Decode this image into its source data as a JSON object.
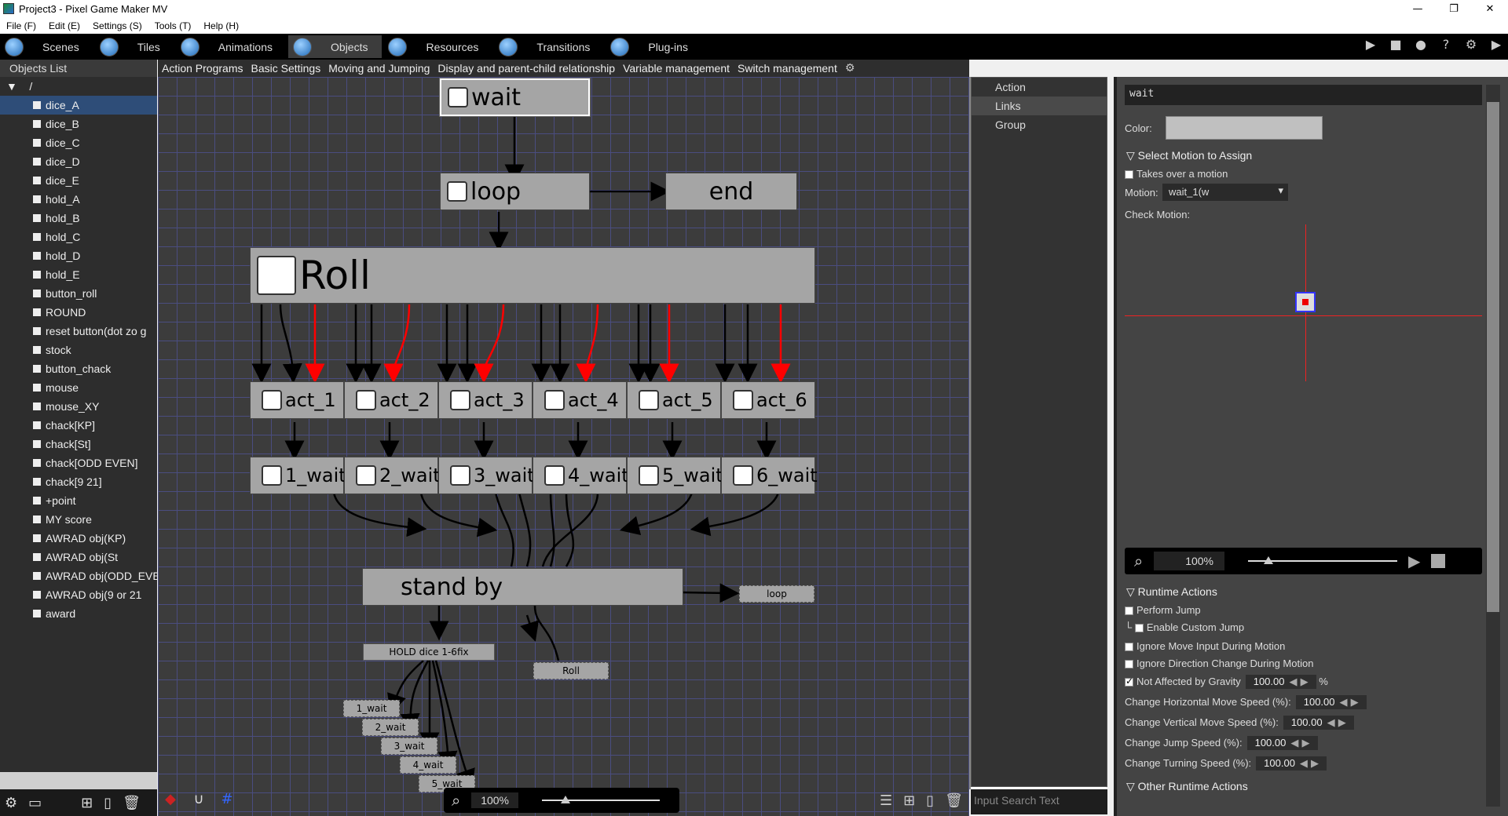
{
  "window": {
    "title": "Project3 - Pixel Game Maker MV",
    "min": "—",
    "max": "❐",
    "close": "✕"
  },
  "menu": [
    "File (F)",
    "Edit (E)",
    "Settings (S)",
    "Tools (T)",
    "Help (H)"
  ],
  "tabs": [
    {
      "label": "Scenes"
    },
    {
      "label": "Tiles"
    },
    {
      "label": "Animations"
    },
    {
      "label": "Objects",
      "active": true
    },
    {
      "label": "Resources"
    },
    {
      "label": "Transitions"
    },
    {
      "label": "Plug-ins"
    }
  ],
  "left": {
    "header": "Objects List",
    "root": "/",
    "items": [
      "dice_A",
      "dice_B",
      "dice_C",
      "dice_D",
      "dice_E",
      "hold_A",
      "hold_B",
      "hold_C",
      "hold_D",
      "hold_E",
      "button_roll",
      "ROUND",
      "reset button(dot zo g",
      "stock",
      "button_chack",
      "mouse",
      "mouse_XY",
      "chack[KP]",
      "chack[St]",
      "chack[ODD EVEN]",
      "chack[9 21]",
      "+point",
      "MY score",
      "AWRAD obj(KP)",
      "AWRAD obj(St",
      "AWRAD obj(ODD_EVEN",
      "AWRAD obj(9 or 21",
      "award"
    ],
    "selected": 0
  },
  "subtabs": [
    "Action Programs",
    "Basic Settings",
    "Moving and Jumping",
    "Display and parent-child relationship",
    "Variable management",
    "Switch management"
  ],
  "graph": {
    "nodes": {
      "wait": "wait",
      "loop": "loop",
      "end": "end",
      "roll": "Roll",
      "acts": [
        "act_1",
        "act_2",
        "act_3",
        "act_4",
        "act_5",
        "act_6"
      ],
      "waits": [
        "1_wait",
        "2_wait",
        "3_wait",
        "4_wait",
        "5_wait",
        "6_wait"
      ],
      "standby": "stand by",
      "loop_small": "loop",
      "hold": "HOLD dice 1-6fix",
      "roll_small": "Roll",
      "hold_children": [
        "1_wait",
        "2_wait",
        "3_wait",
        "4_wait",
        "5_wait"
      ]
    },
    "arrow_color": "#000000",
    "cond_color": "#ff0000",
    "zoom": "100%"
  },
  "links": {
    "items": [
      "Action",
      "Links",
      "Group"
    ],
    "search_placeholder": "Input Search Text"
  },
  "props": {
    "name": "wait",
    "color_label": "Color:",
    "select_motion_label": "Select Motion to Assign",
    "takes_over": "Takes over a motion",
    "motion_label": "Motion:",
    "motion_value": "wait_1(w",
    "check_motion": "Check Motion:",
    "preview_zoom": "100%",
    "runtime_actions": "Runtime Actions",
    "perform_jump": "Perform Jump",
    "enable_custom_jump": "Enable Custom Jump",
    "ignore_move": "Ignore Move Input During Motion",
    "ignore_dir": "Ignore Direction Change During Motion",
    "not_affected": "Not Affected by Gravity",
    "gravity_value": "100.00",
    "percent": "%",
    "h_speed_label": "Change Horizontal Move Speed (%):",
    "h_speed": "100.00",
    "v_speed_label": "Change Vertical Move Speed (%):",
    "v_speed": "100.00",
    "jump_speed_label": "Change Jump Speed (%):",
    "jump_speed": "100.00",
    "turn_speed_label": "Change Turning Speed (%):",
    "turn_speed": "100.00",
    "other_runtime": "Other Runtime Actions"
  }
}
